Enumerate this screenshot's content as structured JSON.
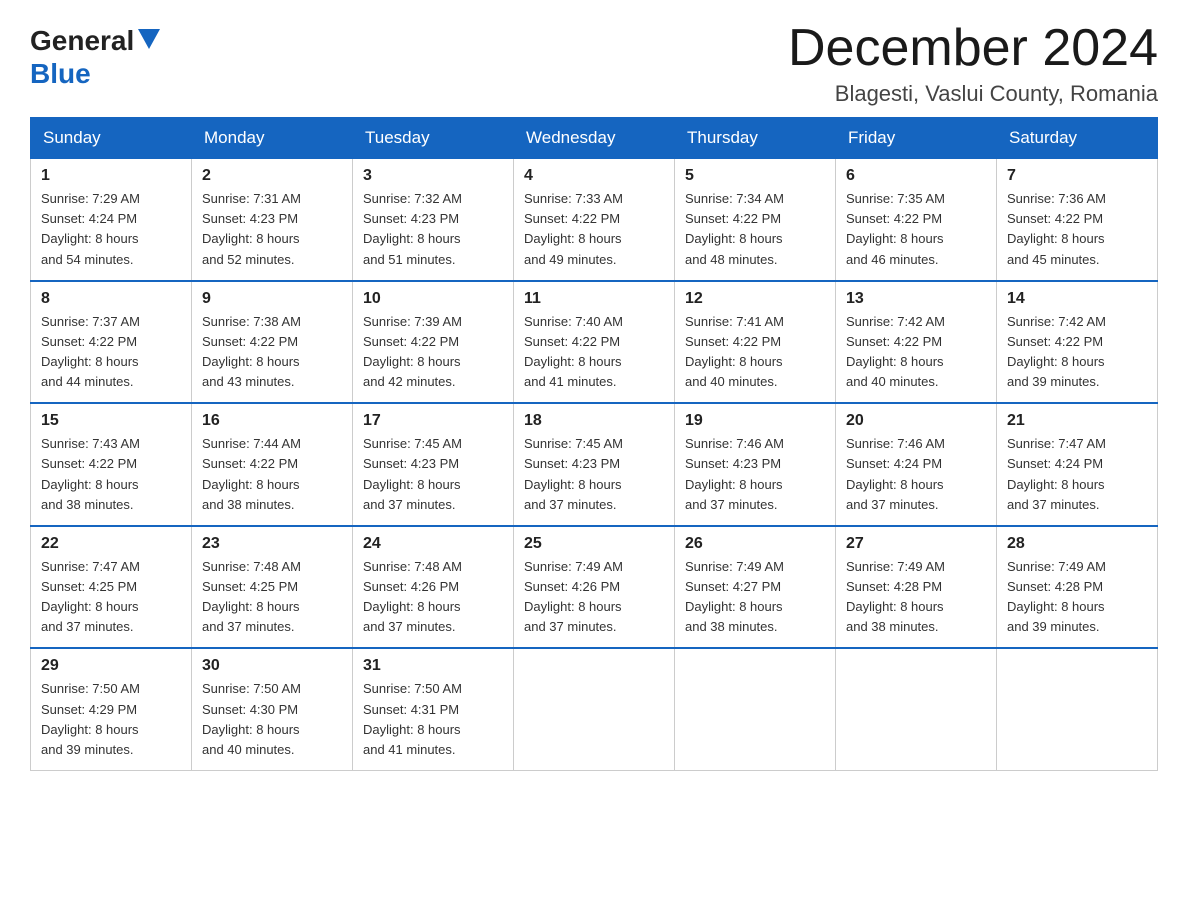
{
  "logo": {
    "general": "General",
    "blue": "Blue"
  },
  "title": {
    "month": "December 2024",
    "location": "Blagesti, Vaslui County, Romania"
  },
  "headers": [
    "Sunday",
    "Monday",
    "Tuesday",
    "Wednesday",
    "Thursday",
    "Friday",
    "Saturday"
  ],
  "weeks": [
    [
      {
        "day": "1",
        "sunrise": "7:29 AM",
        "sunset": "4:24 PM",
        "daylight": "8 hours and 54 minutes."
      },
      {
        "day": "2",
        "sunrise": "7:31 AM",
        "sunset": "4:23 PM",
        "daylight": "8 hours and 52 minutes."
      },
      {
        "day": "3",
        "sunrise": "7:32 AM",
        "sunset": "4:23 PM",
        "daylight": "8 hours and 51 minutes."
      },
      {
        "day": "4",
        "sunrise": "7:33 AM",
        "sunset": "4:22 PM",
        "daylight": "8 hours and 49 minutes."
      },
      {
        "day": "5",
        "sunrise": "7:34 AM",
        "sunset": "4:22 PM",
        "daylight": "8 hours and 48 minutes."
      },
      {
        "day": "6",
        "sunrise": "7:35 AM",
        "sunset": "4:22 PM",
        "daylight": "8 hours and 46 minutes."
      },
      {
        "day": "7",
        "sunrise": "7:36 AM",
        "sunset": "4:22 PM",
        "daylight": "8 hours and 45 minutes."
      }
    ],
    [
      {
        "day": "8",
        "sunrise": "7:37 AM",
        "sunset": "4:22 PM",
        "daylight": "8 hours and 44 minutes."
      },
      {
        "day": "9",
        "sunrise": "7:38 AM",
        "sunset": "4:22 PM",
        "daylight": "8 hours and 43 minutes."
      },
      {
        "day": "10",
        "sunrise": "7:39 AM",
        "sunset": "4:22 PM",
        "daylight": "8 hours and 42 minutes."
      },
      {
        "day": "11",
        "sunrise": "7:40 AM",
        "sunset": "4:22 PM",
        "daylight": "8 hours and 41 minutes."
      },
      {
        "day": "12",
        "sunrise": "7:41 AM",
        "sunset": "4:22 PM",
        "daylight": "8 hours and 40 minutes."
      },
      {
        "day": "13",
        "sunrise": "7:42 AM",
        "sunset": "4:22 PM",
        "daylight": "8 hours and 40 minutes."
      },
      {
        "day": "14",
        "sunrise": "7:42 AM",
        "sunset": "4:22 PM",
        "daylight": "8 hours and 39 minutes."
      }
    ],
    [
      {
        "day": "15",
        "sunrise": "7:43 AM",
        "sunset": "4:22 PM",
        "daylight": "8 hours and 38 minutes."
      },
      {
        "day": "16",
        "sunrise": "7:44 AM",
        "sunset": "4:22 PM",
        "daylight": "8 hours and 38 minutes."
      },
      {
        "day": "17",
        "sunrise": "7:45 AM",
        "sunset": "4:23 PM",
        "daylight": "8 hours and 37 minutes."
      },
      {
        "day": "18",
        "sunrise": "7:45 AM",
        "sunset": "4:23 PM",
        "daylight": "8 hours and 37 minutes."
      },
      {
        "day": "19",
        "sunrise": "7:46 AM",
        "sunset": "4:23 PM",
        "daylight": "8 hours and 37 minutes."
      },
      {
        "day": "20",
        "sunrise": "7:46 AM",
        "sunset": "4:24 PM",
        "daylight": "8 hours and 37 minutes."
      },
      {
        "day": "21",
        "sunrise": "7:47 AM",
        "sunset": "4:24 PM",
        "daylight": "8 hours and 37 minutes."
      }
    ],
    [
      {
        "day": "22",
        "sunrise": "7:47 AM",
        "sunset": "4:25 PM",
        "daylight": "8 hours and 37 minutes."
      },
      {
        "day": "23",
        "sunrise": "7:48 AM",
        "sunset": "4:25 PM",
        "daylight": "8 hours and 37 minutes."
      },
      {
        "day": "24",
        "sunrise": "7:48 AM",
        "sunset": "4:26 PM",
        "daylight": "8 hours and 37 minutes."
      },
      {
        "day": "25",
        "sunrise": "7:49 AM",
        "sunset": "4:26 PM",
        "daylight": "8 hours and 37 minutes."
      },
      {
        "day": "26",
        "sunrise": "7:49 AM",
        "sunset": "4:27 PM",
        "daylight": "8 hours and 38 minutes."
      },
      {
        "day": "27",
        "sunrise": "7:49 AM",
        "sunset": "4:28 PM",
        "daylight": "8 hours and 38 minutes."
      },
      {
        "day": "28",
        "sunrise": "7:49 AM",
        "sunset": "4:28 PM",
        "daylight": "8 hours and 39 minutes."
      }
    ],
    [
      {
        "day": "29",
        "sunrise": "7:50 AM",
        "sunset": "4:29 PM",
        "daylight": "8 hours and 39 minutes."
      },
      {
        "day": "30",
        "sunrise": "7:50 AM",
        "sunset": "4:30 PM",
        "daylight": "8 hours and 40 minutes."
      },
      {
        "day": "31",
        "sunrise": "7:50 AM",
        "sunset": "4:31 PM",
        "daylight": "8 hours and 41 minutes."
      },
      null,
      null,
      null,
      null
    ]
  ],
  "labels": {
    "sunrise": "Sunrise:",
    "sunset": "Sunset:",
    "daylight": "Daylight:"
  }
}
